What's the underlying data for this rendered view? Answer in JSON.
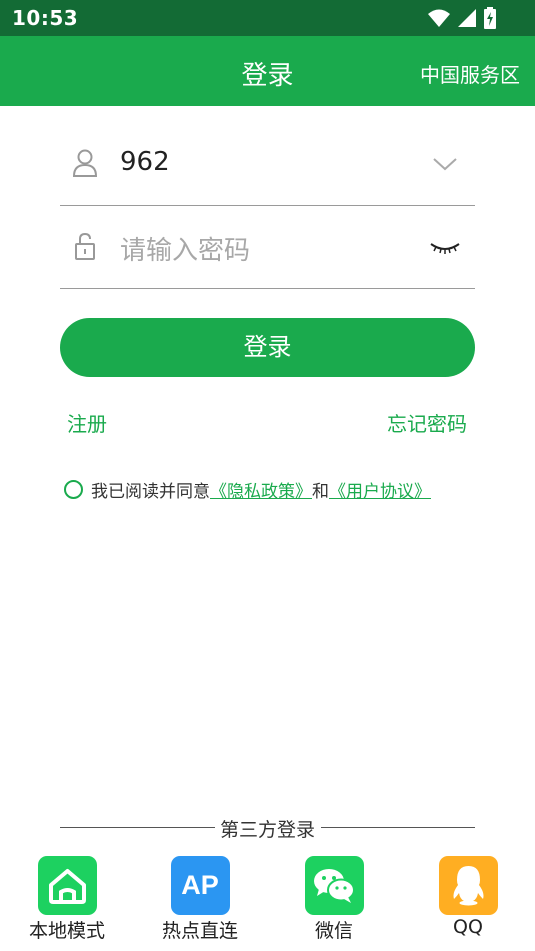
{
  "status_bar": {
    "time": "10:53"
  },
  "app_bar": {
    "title": "登录",
    "region": "中国服务区"
  },
  "username": {
    "value": "962"
  },
  "password": {
    "placeholder": "请输入密码"
  },
  "login_button": {
    "label": "登录"
  },
  "links": {
    "register": "注册",
    "forgot_password": "忘记密码"
  },
  "agreement": {
    "prefix": "我已阅读并同意",
    "privacy_policy": "《隐私政策》",
    "conjunction": "和",
    "user_agreement": "《用户协议》"
  },
  "third_party": {
    "title": "第三方登录",
    "items": [
      {
        "label": "本地模式",
        "icon": "home-icon",
        "color": "#1dd160"
      },
      {
        "label": "热点直连",
        "icon": "ap-icon",
        "icon_text": "AP",
        "color": "#2b96f2"
      },
      {
        "label": "微信",
        "icon": "wechat-icon",
        "color": "#1dd160"
      },
      {
        "label": "QQ",
        "icon": "qq-icon",
        "color": "#ffae22"
      }
    ]
  },
  "colors": {
    "primary": "#1aaa4d",
    "status_bar": "#136b35"
  }
}
